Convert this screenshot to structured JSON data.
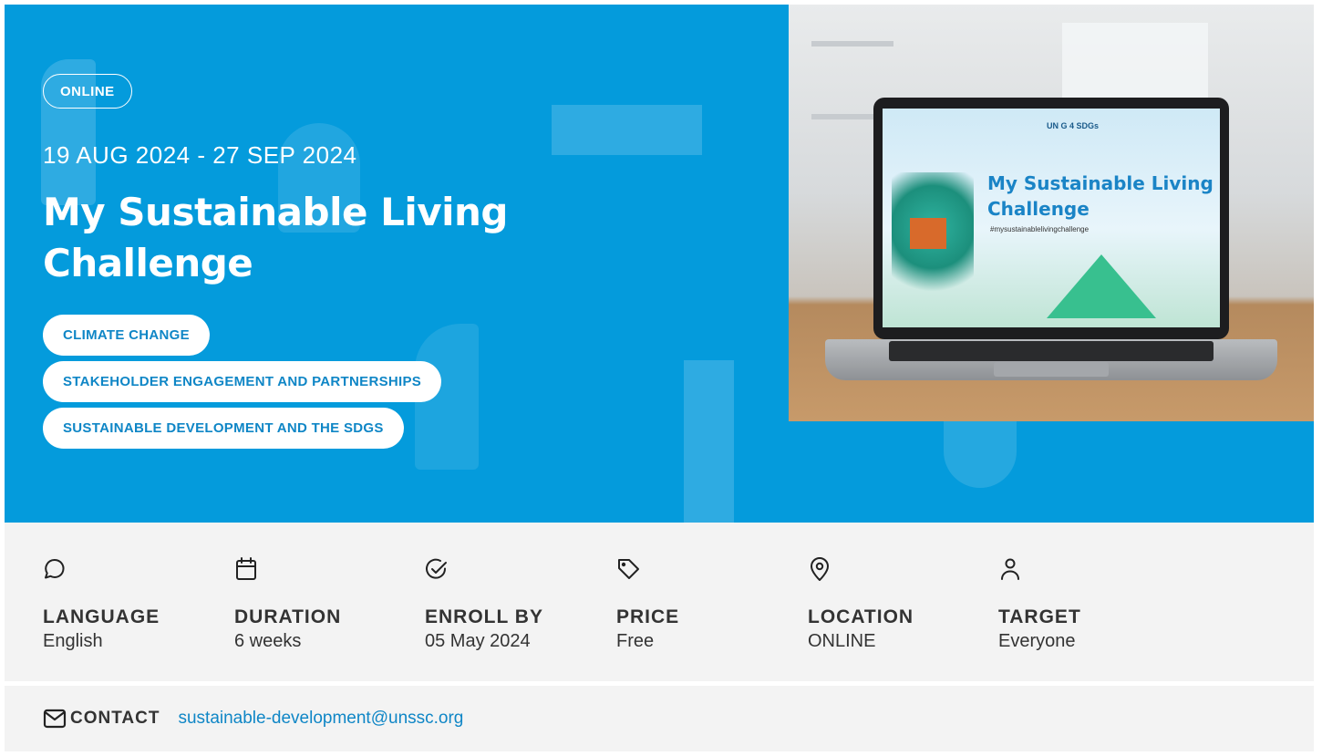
{
  "hero": {
    "format_badge": "ONLINE",
    "date_range": "19 AUG 2024 - 27 SEP 2024",
    "title": "My Sustainable Living Challenge",
    "tags": [
      "CLIMATE CHANGE",
      "STAKEHOLDER ENGAGEMENT AND PARTNERSHIPS",
      "SUSTAINABLE DEVELOPMENT AND THE SDGS"
    ],
    "image": {
      "screen_title": "My Sustainable Living Challenge",
      "screen_hashtag": "#mysustainablelivingchallenge",
      "screen_logos": "UN  G 4 SDGs"
    }
  },
  "details": [
    {
      "icon": "chat-bubble-icon",
      "label": "LANGUAGE",
      "value": "English"
    },
    {
      "icon": "calendar-icon",
      "label": "DURATION",
      "value": "6 weeks"
    },
    {
      "icon": "check-circle-icon",
      "label": "ENROLL BY",
      "value": "05 May 2024"
    },
    {
      "icon": "price-tag-icon",
      "label": "PRICE",
      "value": "Free"
    },
    {
      "icon": "map-pin-icon",
      "label": "LOCATION",
      "value": "ONLINE"
    },
    {
      "icon": "user-icon",
      "label": "TARGET",
      "value": "Everyone"
    }
  ],
  "contact": {
    "icon": "mail-icon",
    "label": "CONTACT",
    "email": "sustainable-development@unssc.org"
  },
  "colors": {
    "hero_bg": "#049bdc",
    "accent": "#0f86c6",
    "meta_bg": "#f3f3f3"
  }
}
